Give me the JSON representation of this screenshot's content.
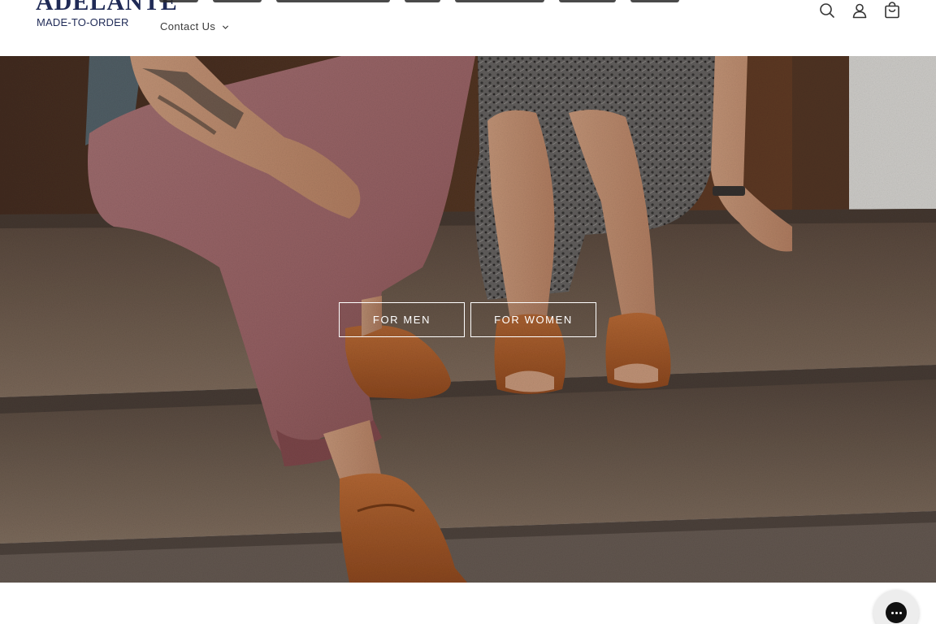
{
  "header": {
    "logo": {
      "word": "ADELANTE",
      "tagline": "MADE-TO-ORDER"
    },
    "nav": {
      "contact_label": "Contact Us"
    },
    "icons": [
      "search-icon",
      "account-icon",
      "cart-icon"
    ]
  },
  "hero": {
    "buttons": {
      "men_label": "FOR MEN",
      "women_label": "FOR WOMEN"
    }
  },
  "chat": {
    "icon": "chat-bubble-icon"
  },
  "colors": {
    "brand_navy": "#1f2a56",
    "button_text": "#ffffff"
  }
}
